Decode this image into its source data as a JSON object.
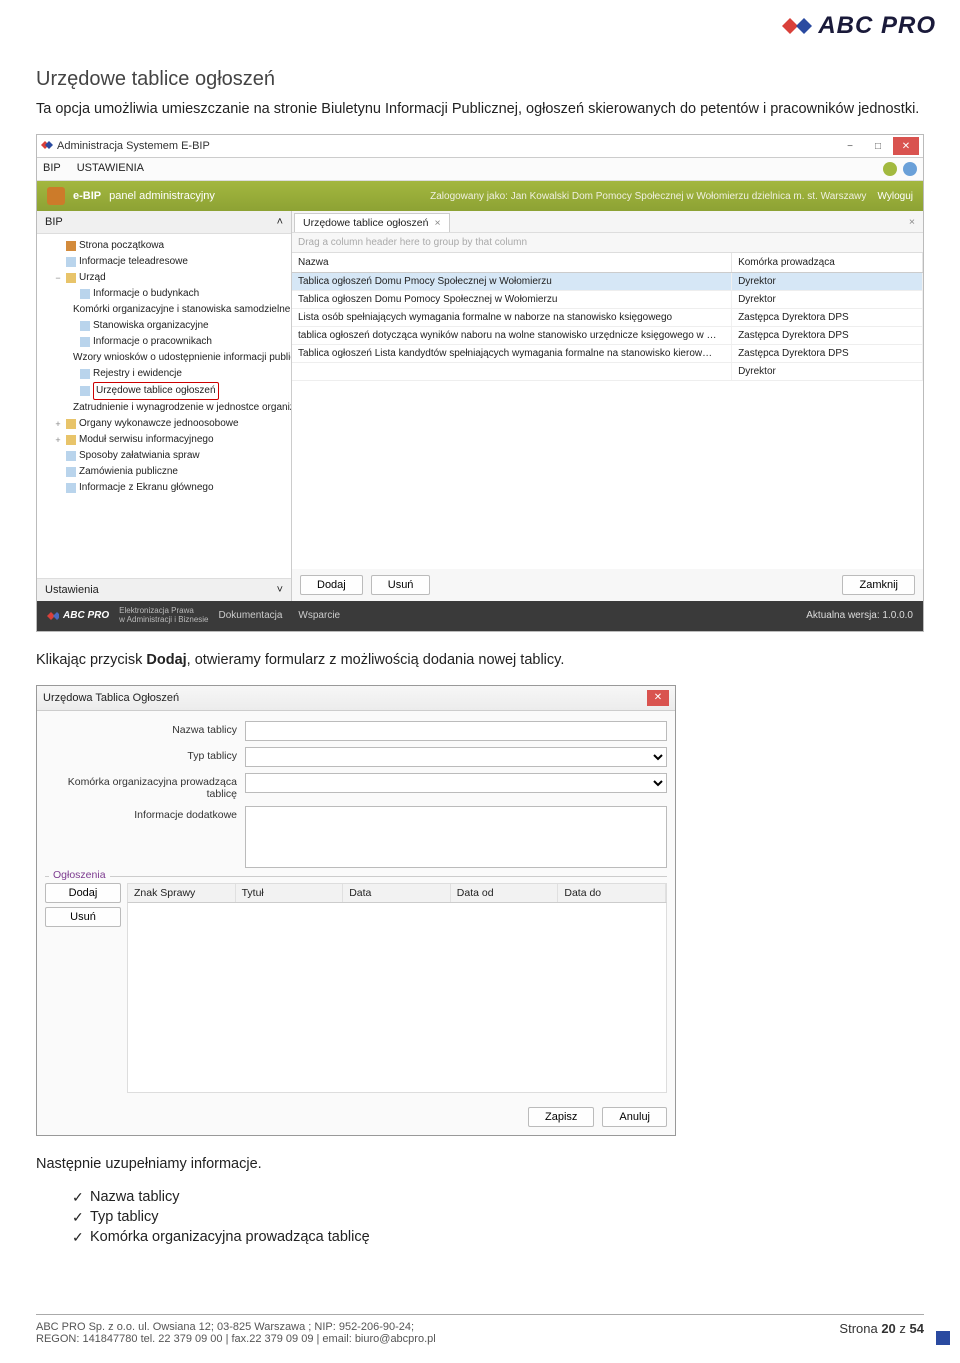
{
  "header": {
    "logo_text": "ABC PRO"
  },
  "doc": {
    "section_title": "Urzędowe tablice ogłoszeń",
    "intro": "Ta opcja umożliwia umieszczanie na stronie Biuletynu Informacji Publicznej, ogłoszeń skierowanych do petentów i pracowników jednostki.",
    "after_shot1_pre": "Klikając przycisk ",
    "after_shot1_bold": "Dodaj",
    "after_shot1_post": ", otwieramy formularz z możliwością dodania nowej tablicy.",
    "after_shot2": "Następnie uzupełniamy informacje.",
    "bullets": [
      "Nazwa tablicy",
      "Typ tablicy",
      "Komórka organizacyjna prowadząca tablicę"
    ]
  },
  "app": {
    "title": "Administracja Systemem E-BIP",
    "menu": {
      "bip": "BIP",
      "ustawienia": "USTAWIENIA"
    },
    "band": {
      "brand": "e-BIP",
      "subtitle": "panel administracyjny",
      "loggedtext": "Zalogowany jako: Jan Kowalski  Dom Pomocy Społecznej w Wołomierzu dzielnica m. st. Warszawy",
      "logout": "Wyloguj"
    },
    "tree": {
      "header": "BIP",
      "footer": "Ustawienia",
      "nodes": [
        {
          "indent": 1,
          "icon": "home",
          "label": "Strona początkowa"
        },
        {
          "indent": 1,
          "icon": "page",
          "label": "Informacje teleadresowe"
        },
        {
          "indent": 1,
          "icon": "folder",
          "exp": "−",
          "label": "Urząd"
        },
        {
          "indent": 2,
          "icon": "page",
          "label": "Informacje o budynkach"
        },
        {
          "indent": 2,
          "icon": "page",
          "label": "Komórki organizacyjne i stanowiska samodzielne"
        },
        {
          "indent": 2,
          "icon": "page",
          "label": "Stanowiska organizacyjne"
        },
        {
          "indent": 2,
          "icon": "page",
          "label": "Informacje o pracownikach"
        },
        {
          "indent": 2,
          "icon": "page",
          "label": "Wzory wniosków o udostępnienie informacji publicznej"
        },
        {
          "indent": 2,
          "icon": "page",
          "label": "Rejestry i ewidencje"
        },
        {
          "indent": 2,
          "icon": "page",
          "label": "Urzędowe tablice ogłoszeń",
          "hl": true
        },
        {
          "indent": 2,
          "icon": "page",
          "label": "Zatrudnienie i wynagrodzenie w jednostce organizacyj"
        },
        {
          "indent": 1,
          "icon": "folder",
          "exp": "+",
          "label": "Organy wykonawcze jednoosobowe"
        },
        {
          "indent": 1,
          "icon": "folder",
          "exp": "+",
          "label": "Moduł serwisu informacyjnego"
        },
        {
          "indent": 1,
          "icon": "page",
          "label": "Sposoby załatwiania spraw"
        },
        {
          "indent": 1,
          "icon": "page",
          "label": "Zamówienia publiczne"
        },
        {
          "indent": 1,
          "icon": "page",
          "label": "Informacje z Ekranu głównego"
        }
      ]
    },
    "tab_label": "Urzędowe tablice ogłoszeń",
    "grid": {
      "drag_hint": "Drag a column header here to group by that column",
      "columns": {
        "name": "Nazwa",
        "unit": "Komórka prowadząca"
      },
      "rows": [
        {
          "name": "Tablica ogłoszeń Domu Pmocy Społecznej w Wołomierzu",
          "unit": "Dyrektor",
          "sel": true
        },
        {
          "name": "Tablica ogłoszen Domu Pomocy Społecznej w Wołomierzu",
          "unit": "Dyrektor"
        },
        {
          "name": "Lista osób spełniających wymagania formalne w naborze na stanowisko księgowego",
          "unit": "Zastępca Dyrektora DPS"
        },
        {
          "name": "tablica ogłoszeń dotycząca wyników naboru na wolne stanowisko urzędnicze księgowego w …",
          "unit": "Zastępca Dyrektora DPS"
        },
        {
          "name": "Tablica ogłoszeń Lista kandydtów spełniających wymagania formalne na stanowisko kierow…",
          "unit": "Zastępca Dyrektora DPS"
        },
        {
          "name": "",
          "unit": "Dyrektor"
        }
      ]
    },
    "buttons": {
      "dodaj": "Dodaj",
      "usun": "Usuń",
      "zamknij": "Zamknij"
    },
    "darkfooter": {
      "brand": "ABC PRO",
      "tagline1": "Elektronizacja Prawa",
      "tagline2": "w Administracji i Biznesie",
      "doc": "Dokumentacja",
      "support": "Wsparcie",
      "version": "Aktualna wersja: 1.0.0.0"
    }
  },
  "dialog": {
    "title": "Urzędowa Tablica Ogłoszeń",
    "labels": {
      "nazwa": "Nazwa tablicy",
      "typ": "Typ tablicy",
      "komorka": "Komórka organizacyjna prowadząca tablicę",
      "info": "Informacje dodatkowe"
    },
    "section": "Ogłoszenia",
    "sub_buttons": {
      "dodaj": "Dodaj",
      "usun": "Usuń"
    },
    "sub_columns": [
      "Znak Sprawy",
      "Tytuł",
      "Data",
      "Data od",
      "Data do"
    ],
    "footer_buttons": {
      "zapisz": "Zapisz",
      "anuluj": "Anuluj"
    }
  },
  "footer": {
    "line1": "ABC PRO Sp. z o.o. ul. Owsiana 12;  03-825 Warszawa ; NIP: 952-206-90-24;",
    "line2": "REGON: 141847780 tel. 22 379 09 00 | fax.22 379 09 09 | email: biuro@abcpro.pl",
    "page_pre": "Strona ",
    "page_num": "20",
    "page_mid": " z ",
    "page_total": "54"
  }
}
